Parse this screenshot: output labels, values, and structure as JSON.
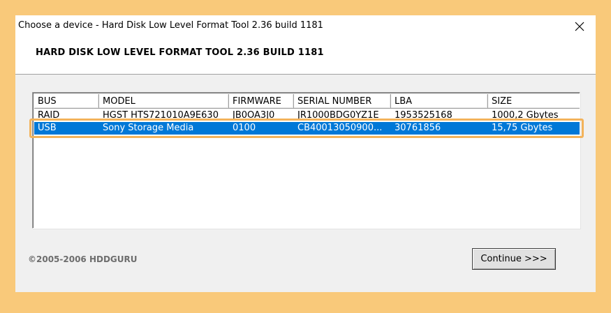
{
  "window": {
    "title": "Choose a device - Hard Disk Low Level Format Tool 2.36 build 1181",
    "close_icon": "close-icon"
  },
  "header": {
    "title": "HARD DISK LOW LEVEL FORMAT TOOL 2.36 BUILD 1181"
  },
  "device_list": {
    "columns": [
      "BUS",
      "MODEL",
      "FIRMWARE",
      "SERIAL NUMBER",
      "LBA",
      "SIZE"
    ],
    "rows": [
      [
        "RAID",
        "HGST HTS721010A9E630",
        "JB0OA3J0",
        "JR1000BDG0YZ1E",
        "1953525168",
        "1000,2 Gbytes"
      ],
      [
        "USB",
        "Sony Storage Media",
        "0100",
        "CB40013050900...",
        "30761856",
        "15,75 Gbytes"
      ]
    ],
    "selected_row": 1
  },
  "footer": {
    "copyright": "©2005-2006 HDDGURU",
    "continue_label": "Continue >>>"
  },
  "colors": {
    "background": "#f9c97a",
    "selection": "#0078d7",
    "highlight": "#f3b35b"
  }
}
